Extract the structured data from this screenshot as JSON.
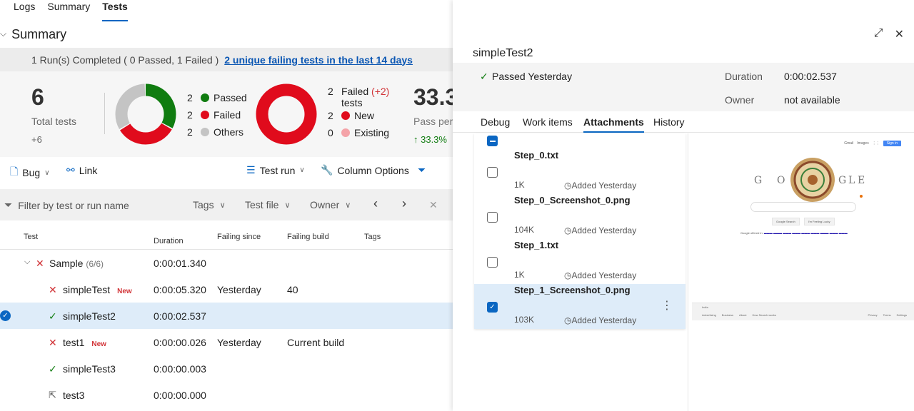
{
  "top_tabs": [
    "Logs",
    "Summary",
    "Tests"
  ],
  "summary": {
    "title": "Summary",
    "run_text": "1 Run(s) Completed ( 0 Passed, 1 Failed )",
    "run_link": "2 unique failing tests in the last 14 days",
    "total_tests": "6",
    "total_label": "Total tests",
    "total_delta": "+6",
    "outcome_legend": [
      {
        "count": "2",
        "label": "Passed",
        "color": "#107c10"
      },
      {
        "count": "2",
        "label": "Failed",
        "color": "#e00b1c"
      },
      {
        "count": "2",
        "label": "Others",
        "color": "#c4c4c4"
      }
    ],
    "failed_legend": {
      "count": "2",
      "label": "Failed",
      "delta": "(+2)",
      "label2": "tests",
      "rows": [
        {
          "count": "2",
          "label": "New",
          "color": "#e00b1c"
        },
        {
          "count": "0",
          "label": "Existing",
          "color": "#f4a3a8"
        }
      ]
    },
    "pass_pct": "33.3",
    "pass_label": "Pass perc",
    "pass_delta": "↑ 33.3%"
  },
  "toolbar": {
    "bug": "Bug",
    "link": "Link",
    "test_run": "Test run",
    "column_options": "Column Options"
  },
  "filter": {
    "placeholder": "Filter by test or run name",
    "tags": "Tags",
    "test_file": "Test file",
    "owner": "Owner"
  },
  "table": {
    "headers": [
      "Test",
      "Duration",
      "Failing since",
      "Failing build",
      "Tags"
    ],
    "group": {
      "name": "Sample",
      "count": "(6/6)",
      "duration": "0:00:01.340"
    },
    "rows": [
      {
        "name": "simpleTest",
        "tag": "New",
        "duration": "0:00:05.320",
        "since": "Yesterday",
        "build": "40"
      },
      {
        "name": "simpleTest2",
        "tag": "",
        "duration": "0:00:02.537",
        "since": "",
        "build": ""
      },
      {
        "name": "test1",
        "tag": "New",
        "duration": "0:00:00.026",
        "since": "Yesterday",
        "build": "Current build"
      },
      {
        "name": "simpleTest3",
        "tag": "",
        "duration": "0:00:00.003",
        "since": "",
        "build": ""
      },
      {
        "name": "test3",
        "tag": "",
        "duration": "0:00:00.000",
        "since": "",
        "build": ""
      }
    ]
  },
  "detail": {
    "title": "simpleTest2",
    "status": "Passed Yesterday",
    "duration_label": "Duration",
    "duration": "0:00:02.537",
    "owner_label": "Owner",
    "owner": "not available",
    "tabs": [
      "Debug",
      "Work items",
      "Attachments",
      "History"
    ],
    "attachments": [
      {
        "name": "Step_0.txt",
        "size": "1K",
        "added": "Added Yesterday"
      },
      {
        "name": "Step_0_Screenshot_0.png",
        "size": "104K",
        "added": "Added Yesterday"
      },
      {
        "name": "Step_1.txt",
        "size": "1K",
        "added": "Added Yesterday"
      },
      {
        "name": "Step_1_Screenshot_0.png",
        "size": "103K",
        "added": "Added Yesterday"
      }
    ]
  },
  "preview": {
    "links": [
      "Gmail",
      "Images"
    ],
    "sign_in": "Sign in",
    "letters": [
      "G",
      "O",
      "G",
      "L",
      "E"
    ],
    "buttons": [
      "Google Search",
      "I'm Feeling Lucky"
    ],
    "offered_label": "Google offered in:",
    "footer_country": "India",
    "footer_left": [
      "Advertising",
      "Business",
      "About",
      "How Search works"
    ],
    "footer_right": [
      "Privacy",
      "Terms",
      "Settings"
    ]
  }
}
